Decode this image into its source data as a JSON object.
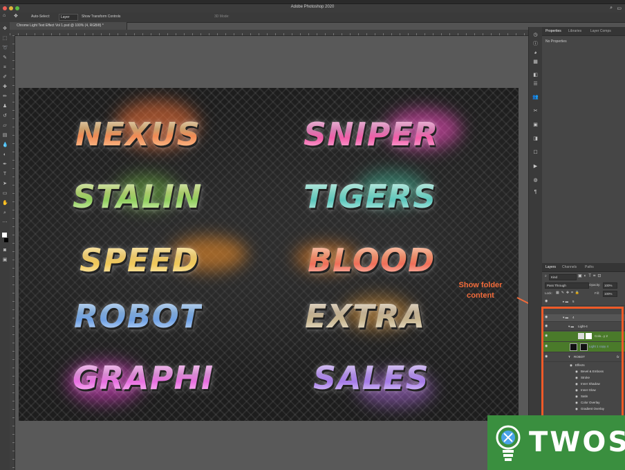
{
  "window": {
    "title": "Adobe Photoshop 2020"
  },
  "options_bar": {
    "auto_select_label": "Auto-Select:",
    "auto_select_value": "Layer",
    "show_transform_label": "Show Transform Controls",
    "mode_label": "3D Mode:"
  },
  "document": {
    "tab_label": "Chrome Light Text Effect Vol 1.psd @ 100% (4, RGB/8) *"
  },
  "canvas": {
    "words": [
      "NEXUS",
      "SNIPER",
      "STALIN",
      "TIGERS",
      "SPEED",
      "BLOOD",
      "ROBOT",
      "EXTRA",
      "GRAPHI",
      "SALES"
    ]
  },
  "annotation": {
    "line1": "Show folder",
    "line2": "content",
    "color": "#f26b3a"
  },
  "properties_panel": {
    "tabs": [
      "Properties",
      "Libraries",
      "Layer Comps"
    ],
    "empty_text": "No Properties"
  },
  "layers_panel": {
    "tabs": [
      "Layers",
      "Channels",
      "Paths"
    ],
    "filter_label": "Kind",
    "blend_mode": "Pass Through",
    "opacity_label": "Opacity:",
    "opacity_value": "100%",
    "lock_label": "Lock:",
    "fill_label": "Fill:",
    "fill_value": "100%",
    "layers": [
      {
        "name": "5"
      },
      {
        "name": "4"
      },
      {
        "name": "Light-4"
      },
      {
        "name": "Colo...y 2"
      },
      {
        "name": "Light 1 copy 4"
      },
      {
        "name": "ROBOT",
        "fx": "fx"
      },
      {
        "name": "Effects"
      },
      {
        "name": "Bevel & Emboss"
      },
      {
        "name": "Stroke"
      },
      {
        "name": "Inner Shadow"
      },
      {
        "name": "Inner Glow"
      },
      {
        "name": "Satin"
      },
      {
        "name": "Color Overlay"
      },
      {
        "name": "Gradient Overlay"
      }
    ]
  },
  "watermark": {
    "brand": "TWOS",
    "bg_color": "#3a8f3f"
  },
  "accent": {
    "highlight": "#f05a28",
    "selected_row": "#4a7a2a"
  }
}
